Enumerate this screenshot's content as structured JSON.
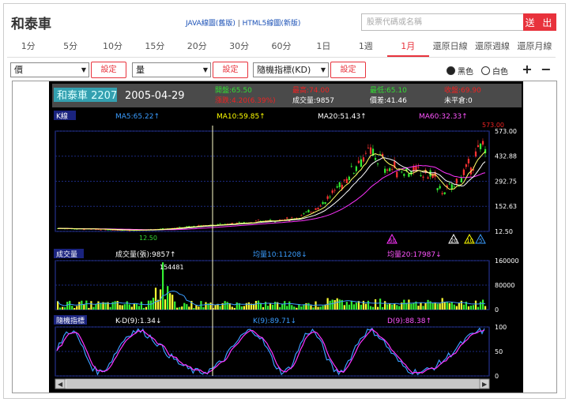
{
  "header": {
    "stock_title": "和泰車",
    "link_java": "JAVA線圖(舊版)",
    "separator": "|",
    "link_html5": "HTML5線圖(新版)",
    "search_placeholder": "股票代碼或名稱",
    "submit_label": "送 出"
  },
  "periods": [
    "1分",
    "5分",
    "10分",
    "15分",
    "20分",
    "30分",
    "60分",
    "1日",
    "1週",
    "1月",
    "還原日線",
    "還原週線",
    "還原月線"
  ],
  "active_period": "1月",
  "controls": {
    "main_select": "價",
    "sub1_select": "量",
    "sub2_select": "隨機指標(KD)",
    "set_label": "設定",
    "radio_black": "黑色",
    "radio_white": "白色",
    "plus": "+",
    "minus": "−"
  },
  "info": {
    "name_code": "和泰車 2207",
    "date": "2005-04-29",
    "open": "開盤:65.50",
    "change": "漲跌:4.20(6.39%)",
    "high": "最高:74.00",
    "low": "最低:65.10",
    "close": "收盤:69.90",
    "volume": "成交量:9857",
    "avg_price": "價差:41.46",
    "unfilled": "未平倉:0"
  },
  "price_panel": {
    "title": "K線",
    "ma5": "MA5:65.22↑",
    "ma10": "MA10:59.85↑",
    "ma20": "MA20:51.43↑",
    "ma60": "MA60:32.33↑",
    "max_label": "573.00",
    "min_label": "12.50",
    "axis_ticks": [
      "573.00",
      "432.88",
      "292.75",
      "152.63",
      "12.50"
    ],
    "axis_values": [
      573.0,
      432.88,
      292.75,
      152.63,
      12.5
    ],
    "markers": [
      "60",
      "20",
      "10",
      "5"
    ],
    "colors": {
      "ma5": "#ffffff",
      "ma10": "#ffff00",
      "ma20": "#ffffff",
      "ma60": "#ff33ff"
    }
  },
  "volume_panel": {
    "title": "成交量",
    "vol_label": "成交量(張):9857↑",
    "ma10": "均量10:11208↓",
    "ma20": "均量20:17987↓",
    "peak_label": "154481",
    "axis_ticks": [
      "160000",
      "80000",
      "0"
    ],
    "axis_values": [
      160000,
      80000,
      0
    ]
  },
  "kd_panel": {
    "title": "隨機指標",
    "kd_label": "K-D(9):1.34↓",
    "k_label": "K(9):89.71↓",
    "d_label": "D(9):88.38↑",
    "axis_ticks": [
      "100",
      "50",
      "0"
    ],
    "axis_values": [
      100,
      50,
      0
    ]
  }
}
